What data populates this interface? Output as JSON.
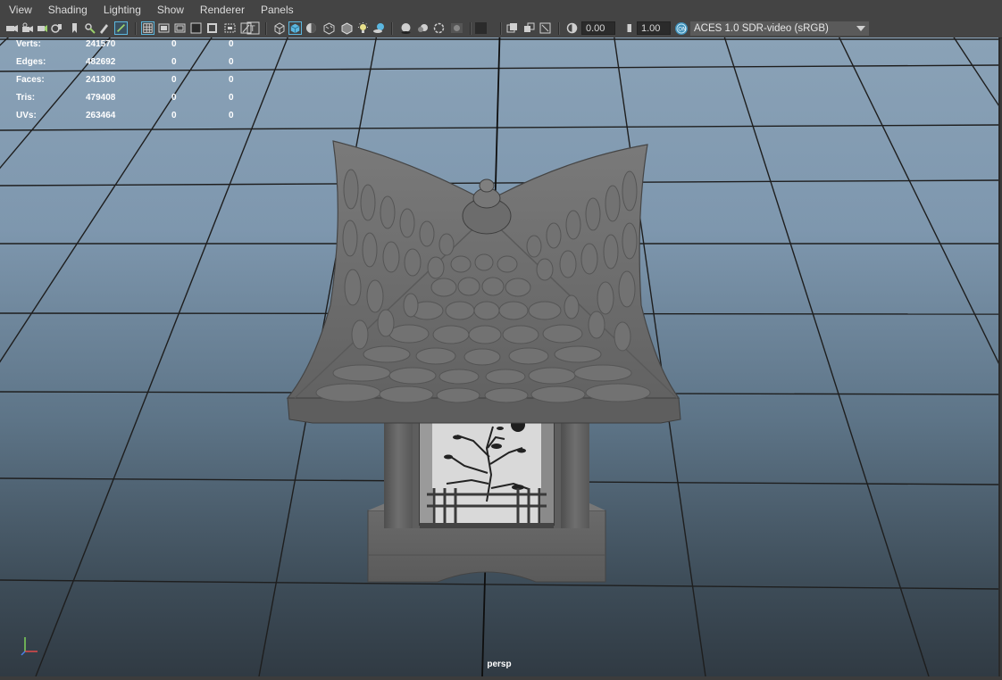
{
  "menu": [
    "View",
    "Shading",
    "Lighting",
    "Show",
    "Renderer",
    "Panels"
  ],
  "toolbar": {
    "field_a": "0.00",
    "field_b": "1.00",
    "colorspace": "ACES 1.0 SDR-video (sRGB)"
  },
  "hud": {
    "rows": [
      {
        "label": "Verts:",
        "values": [
          "241570",
          "0",
          "0"
        ]
      },
      {
        "label": "Edges:",
        "values": [
          "482692",
          "0",
          "0"
        ]
      },
      {
        "label": "Faces:",
        "values": [
          "241300",
          "0",
          "0"
        ]
      },
      {
        "label": "Tris:",
        "values": [
          "479408",
          "0",
          "0"
        ]
      },
      {
        "label": "UVs:",
        "values": [
          "263464",
          "0",
          "0"
        ]
      }
    ]
  },
  "viewport": {
    "camera": "persp"
  },
  "colors": {
    "panel_bg": "#444444",
    "accent_blue": "#5bb7e0",
    "grid_line": "#1e1e1e",
    "model_gray": "#6b6b6b"
  }
}
